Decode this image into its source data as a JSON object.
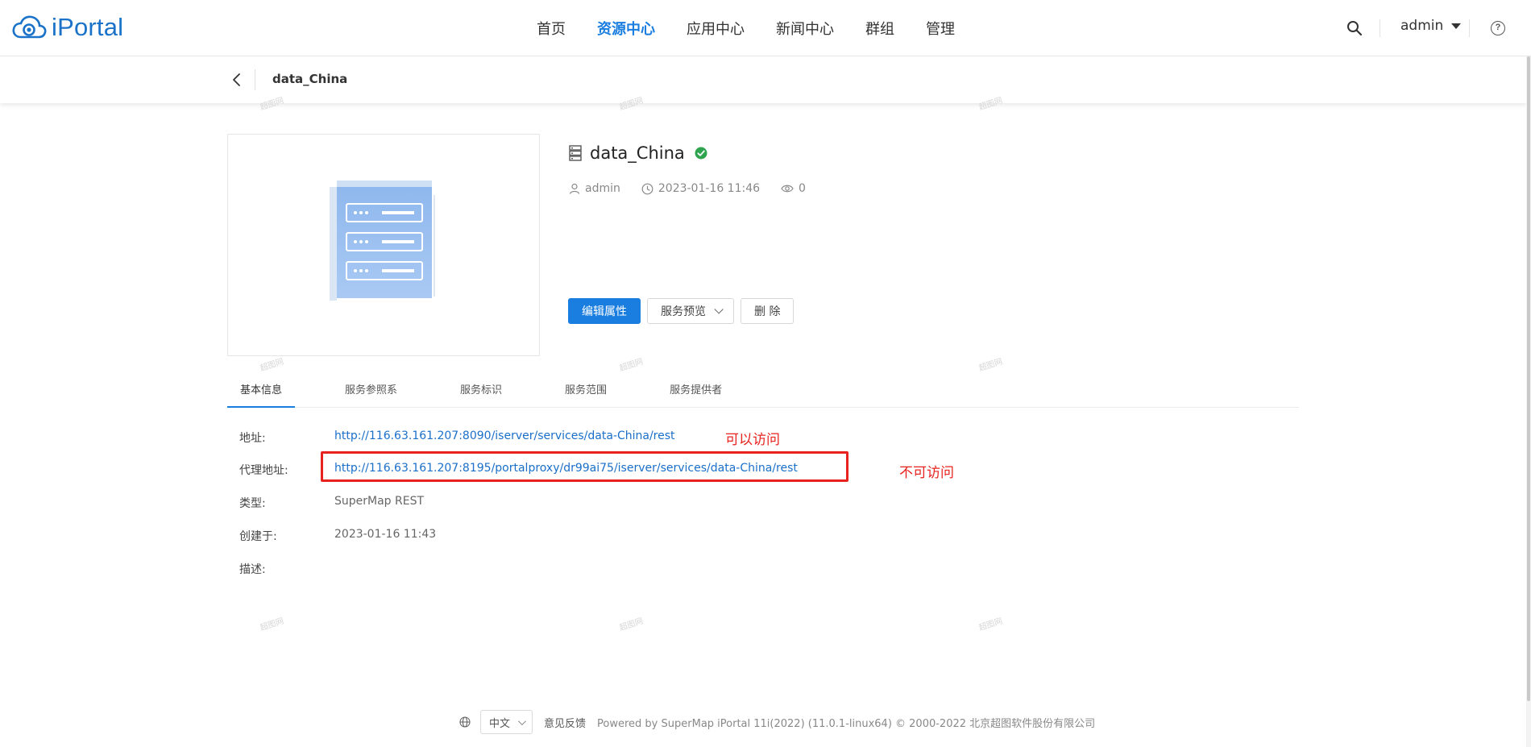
{
  "app": {
    "name": "iPortal"
  },
  "nav": {
    "items": [
      {
        "label": "首页",
        "active": false
      },
      {
        "label": "资源中心",
        "active": true
      },
      {
        "label": "应用中心",
        "active": false
      },
      {
        "label": "新闻中心",
        "active": false
      },
      {
        "label": "群组",
        "active": false
      },
      {
        "label": "管理",
        "active": false
      }
    ],
    "user": "admin"
  },
  "breadcrumb": {
    "title": "data_China"
  },
  "resource": {
    "name": "data_China",
    "owner": "admin",
    "created": "2023-01-16 11:46",
    "views": "0",
    "status_color": "#2ea44f"
  },
  "actions": {
    "edit": "编辑属性",
    "preview": "服务预览",
    "delete": "删 除"
  },
  "tabs": [
    {
      "label": "基本信息",
      "active": true
    },
    {
      "label": "服务参照系",
      "active": false
    },
    {
      "label": "服务标识",
      "active": false
    },
    {
      "label": "服务范围",
      "active": false
    },
    {
      "label": "服务提供者",
      "active": false
    }
  ],
  "info": {
    "address_label": "地址:",
    "address_value": "http://116.63.161.207:8090/iserver/services/data-China/rest",
    "proxy_label": "代理地址:",
    "proxy_value": "http://116.63.161.207:8195/portalproxy/dr99ai75/iserver/services/data-China/rest",
    "type_label": "类型:",
    "type_value": "SuperMap REST",
    "created_label": "创建于:",
    "created_value": "2023-01-16 11:43",
    "desc_label": "描述:"
  },
  "annotations": {
    "ok": "可以访问",
    "fail": "不可访问",
    "color": "#e8221f"
  },
  "footer": {
    "language": "中文",
    "feedback": "意见反馈",
    "powered": "Powered by SuperMap iPortal 11i(2022) (11.0.1-linux64) © 2000-2022 北京超图软件股份有限公司"
  },
  "watermark": "超图网",
  "colors": {
    "accent": "#1a7ee0",
    "link": "#1a6fc9",
    "logo": "#1a73c9"
  }
}
